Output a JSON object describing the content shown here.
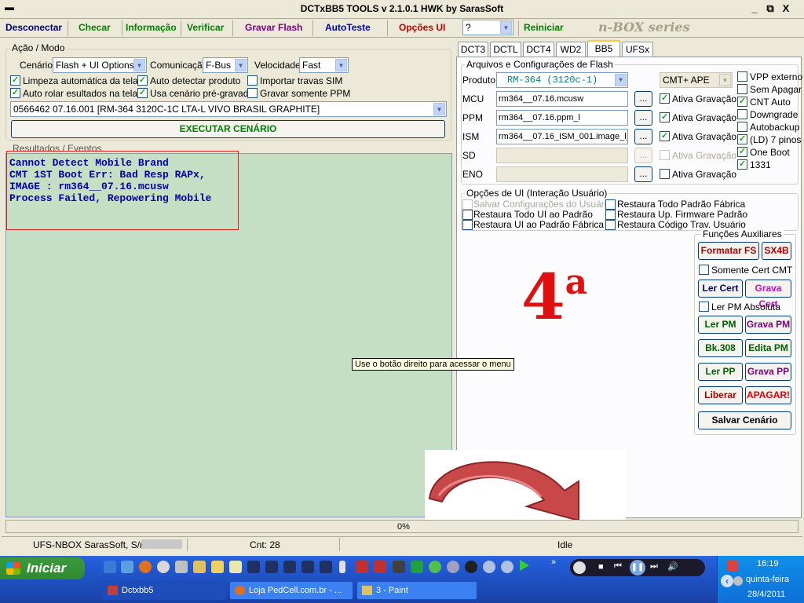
{
  "window": {
    "title": "DCTxBB5 TOOLS v 2.1.0.1 HWK by SarasSoft",
    "sysmenu_icon": "minus-icon",
    "min": "_",
    "max": "□",
    "close": "X"
  },
  "menubar": {
    "items": [
      "Desconectar",
      "Checar",
      "Informação",
      "Verificar",
      "Gravar Flash",
      "AutoTeste",
      "Opções UI"
    ],
    "colors": [
      "#000080",
      "#008000",
      "#008000",
      "#008000",
      "#800080",
      "#0000c0",
      "#c00000"
    ],
    "combo_value": "?",
    "reiniciar": "Reiniciar",
    "brand": "n-BOX series"
  },
  "acao": {
    "group_label": "Ação / Modo",
    "cenario_label": "Cenário",
    "cenario_value": "Flash + UI Options",
    "comunicacao_label": "Comunicação",
    "comunicacao_value": "F-Bus",
    "velocidade_label": "Velocidade",
    "velocidade_value": "Fast",
    "checks": [
      {
        "label": "Limpeza automática da tela",
        "checked": true
      },
      {
        "label": "Auto detectar produto",
        "checked": true
      },
      {
        "label": "Importar travas SIM",
        "checked": false
      },
      {
        "label": "Auto rolar esultados na tela",
        "checked": true
      },
      {
        "label": "Usa cenário pré-gravado",
        "checked": true
      },
      {
        "label": "Gravar somente PPM",
        "checked": false
      }
    ],
    "preset_value": "0566462 07.16.001  [RM-364 3120C-1C LTA-L VIVO BRASIL GRAPHITE]",
    "executar": "EXECUTAR CENÁRIO"
  },
  "results": {
    "label": "Resultados / Eventos",
    "lines": [
      "Cannot Detect Mobile Brand",
      "CMT 1ST Boot Err: Bad Resp RAPx,",
      "IMAGE : rm364__07.16.mcusw",
      "Process Failed, Repowering Mobile"
    ]
  },
  "tooltip": "Use o botão direito para acessar o menu",
  "tabs": [
    "DCT3",
    "DCTL",
    "DCT4",
    "WD2",
    "BB5",
    "UFSx"
  ],
  "active_tab": "BB5",
  "flash": {
    "group_label": "Arquivos e Configurações de Flash",
    "produto_label": "Produto",
    "produto_value": "RM-364  (3120c-1)",
    "mode_value": "CMT+ APE",
    "files": [
      {
        "label": "MCU",
        "value": "rm364__07.16.mcusw",
        "ativa": "Ativa Gravação",
        "checked": true,
        "enabled": true
      },
      {
        "label": "PPM",
        "value": "rm364__07.16.ppm_l",
        "ativa": "Ativa Gravação",
        "checked": true,
        "enabled": true
      },
      {
        "label": "ISM",
        "value": "rm364__07.16_ISM_001.image_l_",
        "ativa": "Ativa Gravação",
        "checked": true,
        "enabled": true
      },
      {
        "label": "SD",
        "value": "",
        "ativa": "Ativa Gravação",
        "checked": false,
        "enabled": false
      },
      {
        "label": "ENO",
        "value": "",
        "ativa": "Ativa Gravação",
        "checked": false,
        "enabled": true
      }
    ],
    "browse": "...",
    "options": [
      {
        "label": "VPP externo",
        "checked": false
      },
      {
        "label": "Sem Apagar",
        "checked": false
      },
      {
        "label": "CNT Auto",
        "checked": true
      },
      {
        "label": "Downgrade",
        "checked": false
      },
      {
        "label": "Autobackup",
        "checked": false
      },
      {
        "label": "(LD) 7 pinos",
        "checked": true
      },
      {
        "label": "One Boot",
        "checked": true
      },
      {
        "label": "1331",
        "checked": true
      }
    ]
  },
  "uiopts": {
    "group_label": "Opções de UI (Interação Usuário)",
    "items": [
      {
        "label": "Salvar Configurações do Usuário",
        "disabled": true
      },
      {
        "label": "Restaura Todo Padrão Fábrica",
        "disabled": false
      },
      {
        "label": "Restaura Todo UI ao Padrão",
        "disabled": false
      },
      {
        "label": "Restaura Up. Firmware Padrão",
        "disabled": false
      },
      {
        "label": "Restaura UI ao Padrão Fábrica",
        "disabled": false
      },
      {
        "label": "Restaura Código Trav. Usuário",
        "disabled": false
      }
    ]
  },
  "funcoes": {
    "group_label": "Funções Auxiliares",
    "formatar": "Formatar FS",
    "sx4b": "SX4B",
    "somente_cert": "Somente Cert CMT",
    "ler_cert": "Ler Cert",
    "grava_cert": "Grava Cert",
    "ler_pm_abs": "Ler PM Absoluta",
    "ler_pm": "Ler PM",
    "grava_pm": "Grava PM",
    "bk308": "Bk.308",
    "edita_pm": "Edita PM",
    "ler_pp": "Ler PP",
    "grava_pp": "Grava PP",
    "liberar": "Liberar",
    "apagar": "APAGAR!",
    "salvar": "Salvar Cenário"
  },
  "overlay": {
    "step_number": "4",
    "step_suffix": "a"
  },
  "progress": {
    "text": "0%",
    "value": 0
  },
  "status": {
    "serial": "UFS-NBOX  SarasSoft, S/n:",
    "cnt": "Cnt: 28",
    "state": "Idle"
  },
  "taskbar": {
    "start": "Iniciar",
    "windows": [
      {
        "label": "Dctxbb5",
        "active": true
      },
      {
        "label": "Loja PedCell.com.br - ...",
        "active": false
      },
      {
        "label": "3 - Paint",
        "active": false
      }
    ],
    "time": "16:19",
    "day": "quinta-feira",
    "date": "28/4/2011"
  }
}
